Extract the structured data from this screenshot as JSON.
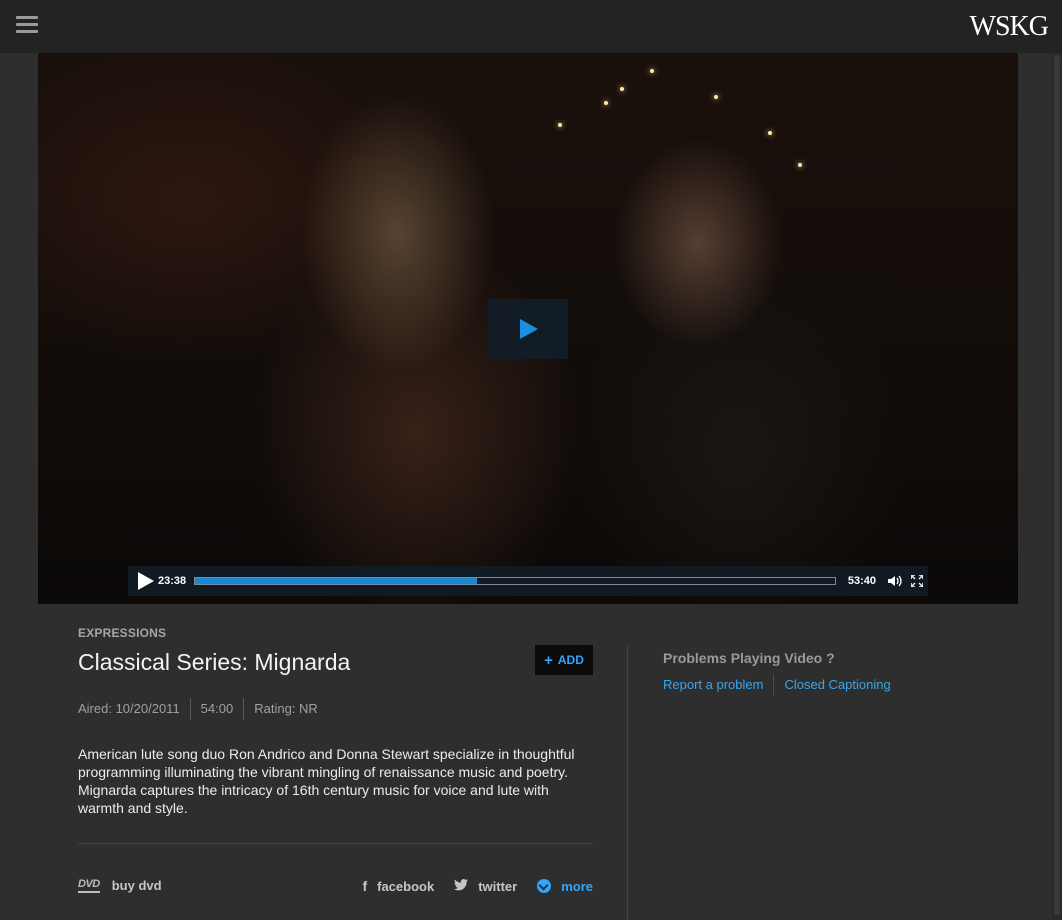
{
  "header": {
    "logo_text": "WSKG",
    "menu_icon": "hamburger-icon"
  },
  "player": {
    "current_time": "23:38",
    "duration": "53:40",
    "progress_fraction": 0.44,
    "play_icon": "play-icon",
    "volume_icon": "volume-icon",
    "fullscreen_icon": "fullscreen-icon",
    "accent_color": "#1a87d6"
  },
  "video": {
    "category": "EXPRESSIONS",
    "title": "Classical Series: Mignarda",
    "add_label": "ADD",
    "aired": "Aired: 10/20/2011",
    "length": "54:00",
    "rating": "Rating: NR",
    "description": "American lute song duo Ron Andrico and Donna Stewart specialize in thoughtful programming illuminating the vibrant mingling of renaissance music and poetry. Mignarda captures the intricacy of 16th century music for voice and lute with warmth and style."
  },
  "footer": {
    "dvd_icon_text": "DVD",
    "buy_dvd": "buy dvd",
    "facebook": "facebook",
    "twitter": "twitter",
    "more": "more"
  },
  "help": {
    "title": "Problems Playing Video ?",
    "report": "Report a problem",
    "captions": "Closed Captioning"
  }
}
